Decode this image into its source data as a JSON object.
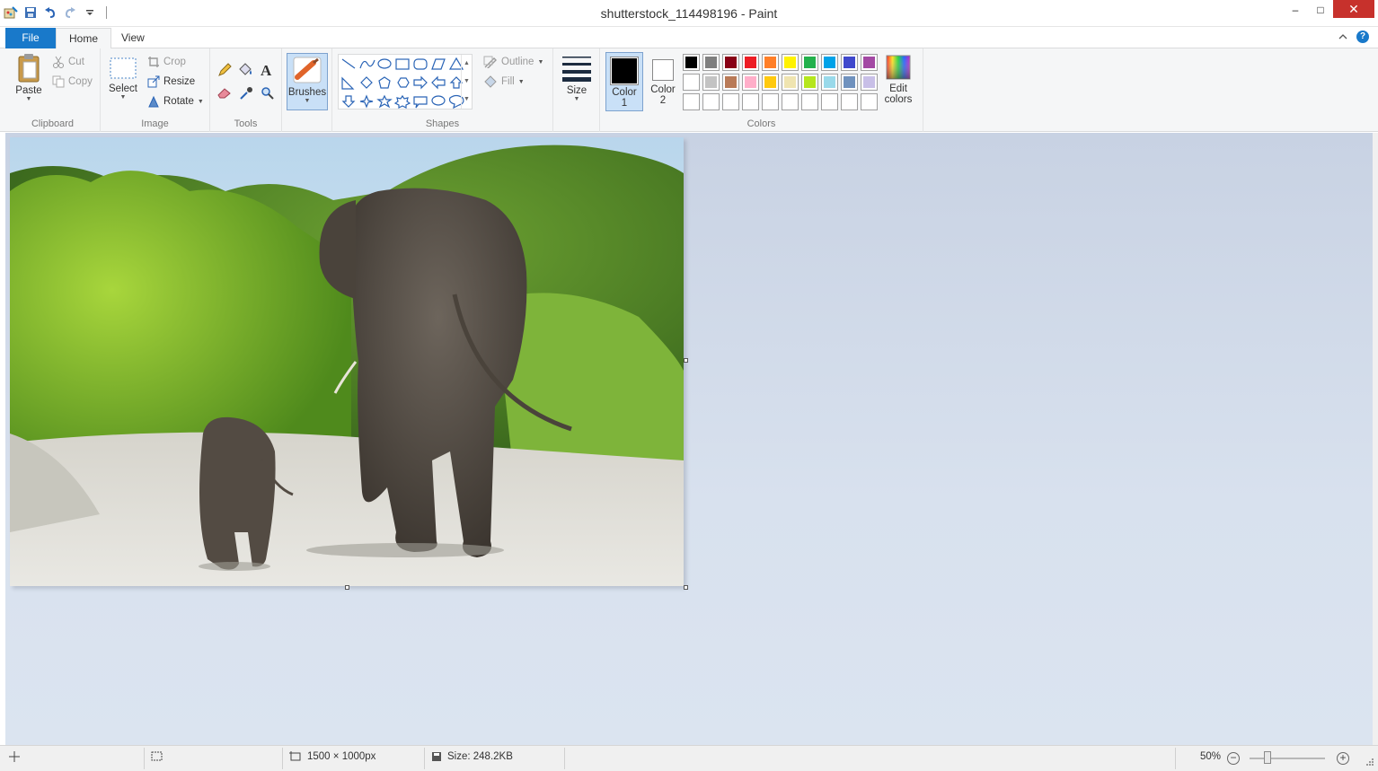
{
  "window": {
    "title": "shutterstock_114498196 - Paint",
    "minimize": "‒",
    "maximize": "□",
    "close": "✕"
  },
  "tabs": {
    "file": "File",
    "home": "Home",
    "view": "View"
  },
  "clipboard": {
    "paste": "Paste",
    "cut": "Cut",
    "copy": "Copy",
    "group": "Clipboard"
  },
  "image": {
    "select": "Select",
    "crop": "Crop",
    "resize": "Resize",
    "rotate": "Rotate",
    "group": "Image"
  },
  "tools": {
    "group": "Tools",
    "text_glyph": "A"
  },
  "brushes": {
    "label": "Brushes"
  },
  "shapes": {
    "outline": "Outline",
    "fill": "Fill",
    "group": "Shapes"
  },
  "size": {
    "label": "Size"
  },
  "colors": {
    "color1_line1": "Color",
    "color1_line2": "1",
    "color2_line1": "Color",
    "color2_line2": "2",
    "edit_line1": "Edit",
    "edit_line2": "colors",
    "group": "Colors",
    "color1": "#000000",
    "color2": "#ffffff",
    "palette_row1": [
      "#000000",
      "#7f7f7f",
      "#880015",
      "#ed1c24",
      "#ff7f27",
      "#fff200",
      "#22b14c",
      "#00a2e8",
      "#3f48cc",
      "#a349a4"
    ],
    "palette_row2": [
      "#ffffff",
      "#c3c3c3",
      "#b97a57",
      "#ffaec9",
      "#ffc90e",
      "#efe4b0",
      "#b5e61d",
      "#99d9ea",
      "#7092be",
      "#c8bfe7"
    ],
    "palette_row3": [
      "#ffffff",
      "#ffffff",
      "#ffffff",
      "#ffffff",
      "#ffffff",
      "#ffffff",
      "#ffffff",
      "#ffffff",
      "#ffffff",
      "#ffffff"
    ]
  },
  "status": {
    "dimensions": "1500 × 1000px",
    "size": "Size: 248.2KB",
    "zoom": "50%",
    "zoom_out": "−",
    "zoom_in": "+"
  }
}
